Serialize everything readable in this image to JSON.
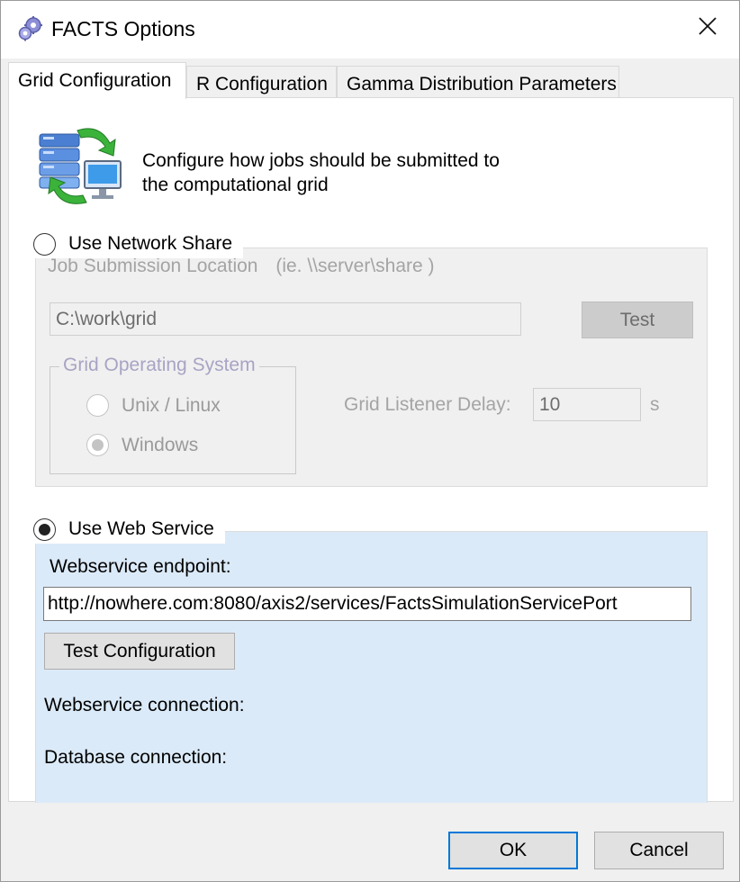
{
  "window": {
    "title": "FACTS Options",
    "close_glyph": "✕"
  },
  "tabs": [
    {
      "label": "Grid Configuration",
      "active": true
    },
    {
      "label": "R Configuration",
      "active": false
    },
    {
      "label": "Gamma Distribution Parameters",
      "active": false
    }
  ],
  "header": {
    "icon": "server-sync-icon",
    "line1": "Configure how jobs should be submitted to",
    "line2": "the computational grid"
  },
  "network_share": {
    "label": "Use Network Share",
    "selected": false,
    "job_location_label": "Job Submission Location",
    "job_location_hint": "(ie. \\\\server\\share )",
    "job_location_value": "C:\\work\\grid",
    "test_label": "Test",
    "os_group_label": "Grid Operating System",
    "os_options": [
      {
        "label": "Unix / Linux",
        "selected": false
      },
      {
        "label": "Windows",
        "selected": true
      }
    ],
    "delay_label": "Grid Listener Delay:",
    "delay_value": "10",
    "delay_unit": "s"
  },
  "web_service": {
    "label": "Use Web Service",
    "selected": true,
    "endpoint_label": "Webservice endpoint:",
    "endpoint_value": "http://nowhere.com:8080/axis2/services/FactsSimulationServicePort",
    "test_config_label": "Test Configuration",
    "ws_connection_label": "Webservice connection:",
    "db_connection_label": "Database connection:"
  },
  "footer": {
    "ok_label": "OK",
    "cancel_label": "Cancel"
  },
  "colors": {
    "accent": "#0078d7",
    "web_panel_bg": "#dbeaf8",
    "disabled_text": "#a4a4a4"
  }
}
